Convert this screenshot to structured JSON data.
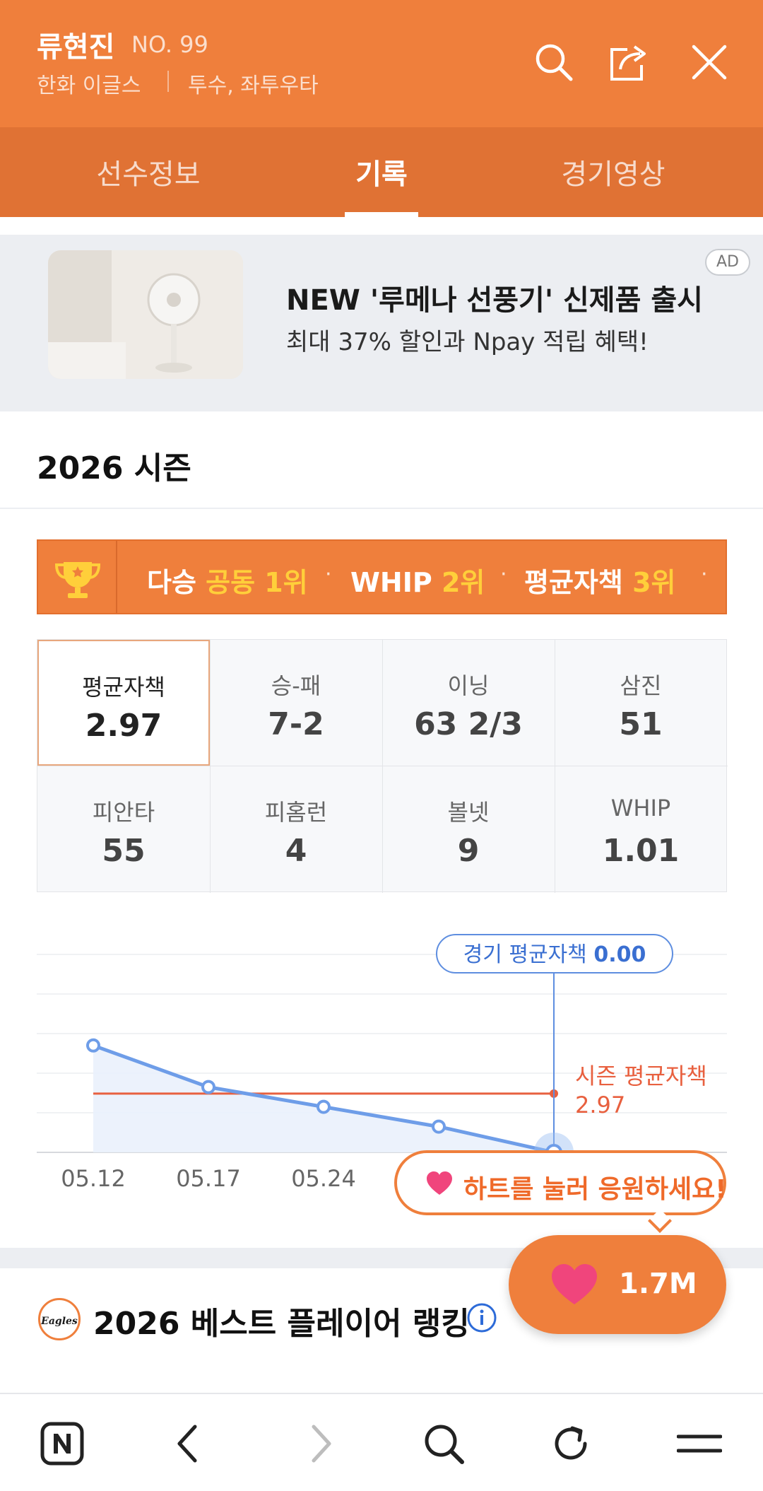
{
  "header": {
    "player_name": "류현진",
    "player_number": "NO. 99",
    "team": "한화 이글스",
    "position": "투수, 좌투우타",
    "icons": [
      "search-icon",
      "share-icon",
      "close-icon"
    ]
  },
  "tabs": [
    {
      "label": "선수정보",
      "active": false
    },
    {
      "label": "기록",
      "active": true
    },
    {
      "label": "경기영상",
      "active": false
    }
  ],
  "ad": {
    "title": "NEW '루메나 선풍기' 신제품 출시",
    "desc": "최대 37% 할인과 Npay 적립 혜택!",
    "badge": "AD"
  },
  "season": {
    "title": "2026 시즌"
  },
  "ranking_bar": {
    "items": [
      {
        "label": "다승",
        "rank": "공동 1위"
      },
      {
        "label": "WHIP",
        "rank": "2위"
      },
      {
        "label": "평균자책",
        "rank": "3위"
      }
    ],
    "separator": "·"
  },
  "stats": [
    {
      "label": "평균자책",
      "value": "2.97",
      "selected": true
    },
    {
      "label": "승-패",
      "value": "7-2"
    },
    {
      "label": "이닝",
      "value": "63 2/3"
    },
    {
      "label": "삼진",
      "value": "51"
    },
    {
      "label": "피안타",
      "value": "55"
    },
    {
      "label": "피홈런",
      "value": "4"
    },
    {
      "label": "볼넷",
      "value": "9"
    },
    {
      "label": "WHIP",
      "value": "1.01"
    }
  ],
  "chart_data": {
    "type": "line",
    "x": [
      "05.12",
      "05.17",
      "05.24",
      "",
      ""
    ],
    "x_labels_visible": [
      "05.12",
      "05.17",
      "05.24"
    ],
    "series": [
      {
        "values": [
          5.4,
          3.3,
          2.3,
          1.3,
          0.0
        ]
      }
    ],
    "season_avg": {
      "label": "시즌 평균자책",
      "value": "2.97"
    },
    "tooltip": {
      "label": "경기 평균자책",
      "value": "0.00"
    },
    "ylim": [
      0,
      10
    ],
    "grid": true,
    "colors": {
      "line": "#6e9de8",
      "avg": "#e8603f"
    }
  },
  "cheer": {
    "bubble_text": "하트를 눌러 응원하세요!",
    "count": "1.7M"
  },
  "best_ranking": {
    "title": "2026 베스트 플레이어 랭킹",
    "info_icon": "info-icon"
  },
  "colors": {
    "brand": "#ef7f3c",
    "tab_bar": "#e07234",
    "highlight": "#ffcf3a"
  },
  "bottom_nav": [
    "naver-home-icon",
    "back-icon",
    "forward-icon",
    "search-icon",
    "refresh-icon",
    "menu-icon"
  ]
}
